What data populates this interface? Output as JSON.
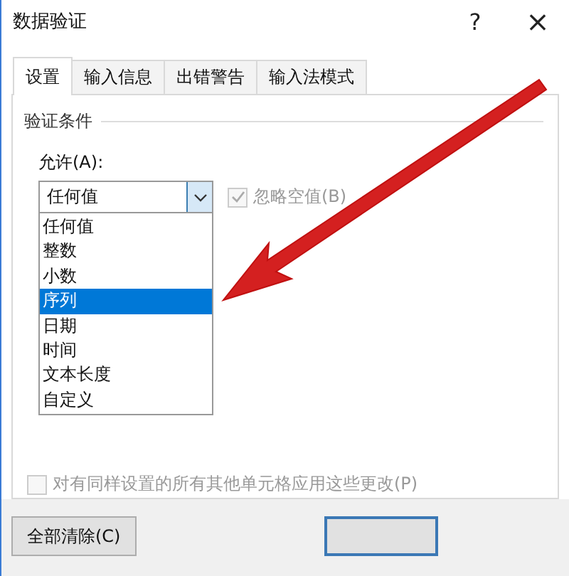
{
  "window": {
    "title": "数据验证",
    "help": "?",
    "close": "×"
  },
  "tabs": [
    {
      "label": "设置",
      "selected": true
    },
    {
      "label": "输入信息",
      "selected": false
    },
    {
      "label": "出错警告",
      "selected": false
    },
    {
      "label": "输入法模式",
      "selected": false
    }
  ],
  "section": "验证条件",
  "allow": {
    "label": "允许(A):",
    "value": "任何值",
    "ignore_blank": {
      "label": "忽略空值(B)",
      "checked": true,
      "disabled": true
    }
  },
  "dropdown": [
    {
      "label": "任何值",
      "selected": false
    },
    {
      "label": "整数",
      "selected": false
    },
    {
      "label": "小数",
      "selected": false
    },
    {
      "label": "序列",
      "selected": true
    },
    {
      "label": "日期",
      "selected": false
    },
    {
      "label": "时间",
      "selected": false
    },
    {
      "label": "文本长度",
      "selected": false
    },
    {
      "label": "自定义",
      "selected": false
    }
  ],
  "apply_all": {
    "label": "对有同样设置的所有其他单元格应用这些更改(P)",
    "checked": false,
    "disabled": true
  },
  "buttons": {
    "clear": "全部清除(C)"
  }
}
